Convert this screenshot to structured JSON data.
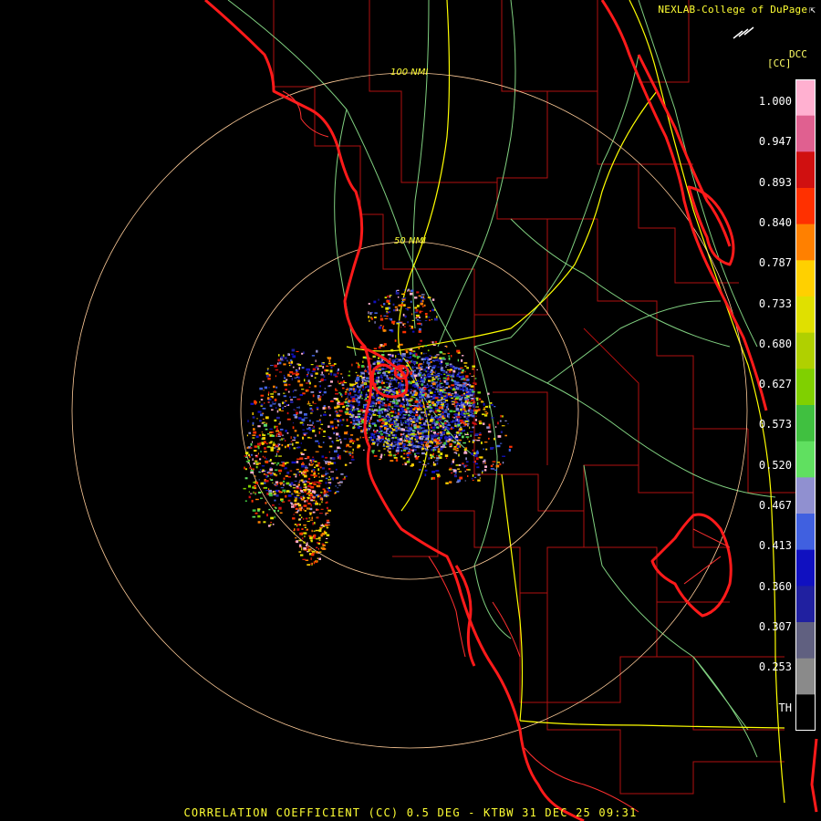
{
  "header": {
    "brand": "NEXLAB-College of DuPage",
    "brand_icon": "cursor-icon",
    "legend_unit_top": "DCC",
    "legend_unit": "[CC]"
  },
  "map": {
    "radar_site": "KTBW",
    "range_rings": [
      {
        "label": "100 NMI"
      },
      {
        "label": "50 NMI"
      }
    ],
    "colors": {
      "background": "#000000",
      "coastline": "#ff1a1a",
      "county_lines": "#b01010",
      "highways_major": "#ffff00",
      "highways_minor": "#80d080",
      "range_rings": "#ffcc99"
    }
  },
  "legend": {
    "ticks": [
      "1.000",
      "0.947",
      "0.893",
      "0.840",
      "0.787",
      "0.733",
      "0.680",
      "0.627",
      "0.573",
      "0.520",
      "0.467",
      "0.413",
      "0.360",
      "0.307",
      "0.253",
      "TH"
    ],
    "colors": [
      "#ffb0d0",
      "#e06090",
      "#d01010",
      "#ff3000",
      "#ff8000",
      "#ffd000",
      "#e0e000",
      "#b0d000",
      "#80d000",
      "#40c040",
      "#60e060",
      "#9090d0",
      "#4060e0",
      "#1010c0",
      "#2020a0",
      "#606080",
      "#8a8a8a",
      "#000000"
    ]
  },
  "footer": {
    "caption": "CORRELATION COEFFICIENT (CC) 0.5 DEG - KTBW 31 DEC 25 09:31"
  }
}
